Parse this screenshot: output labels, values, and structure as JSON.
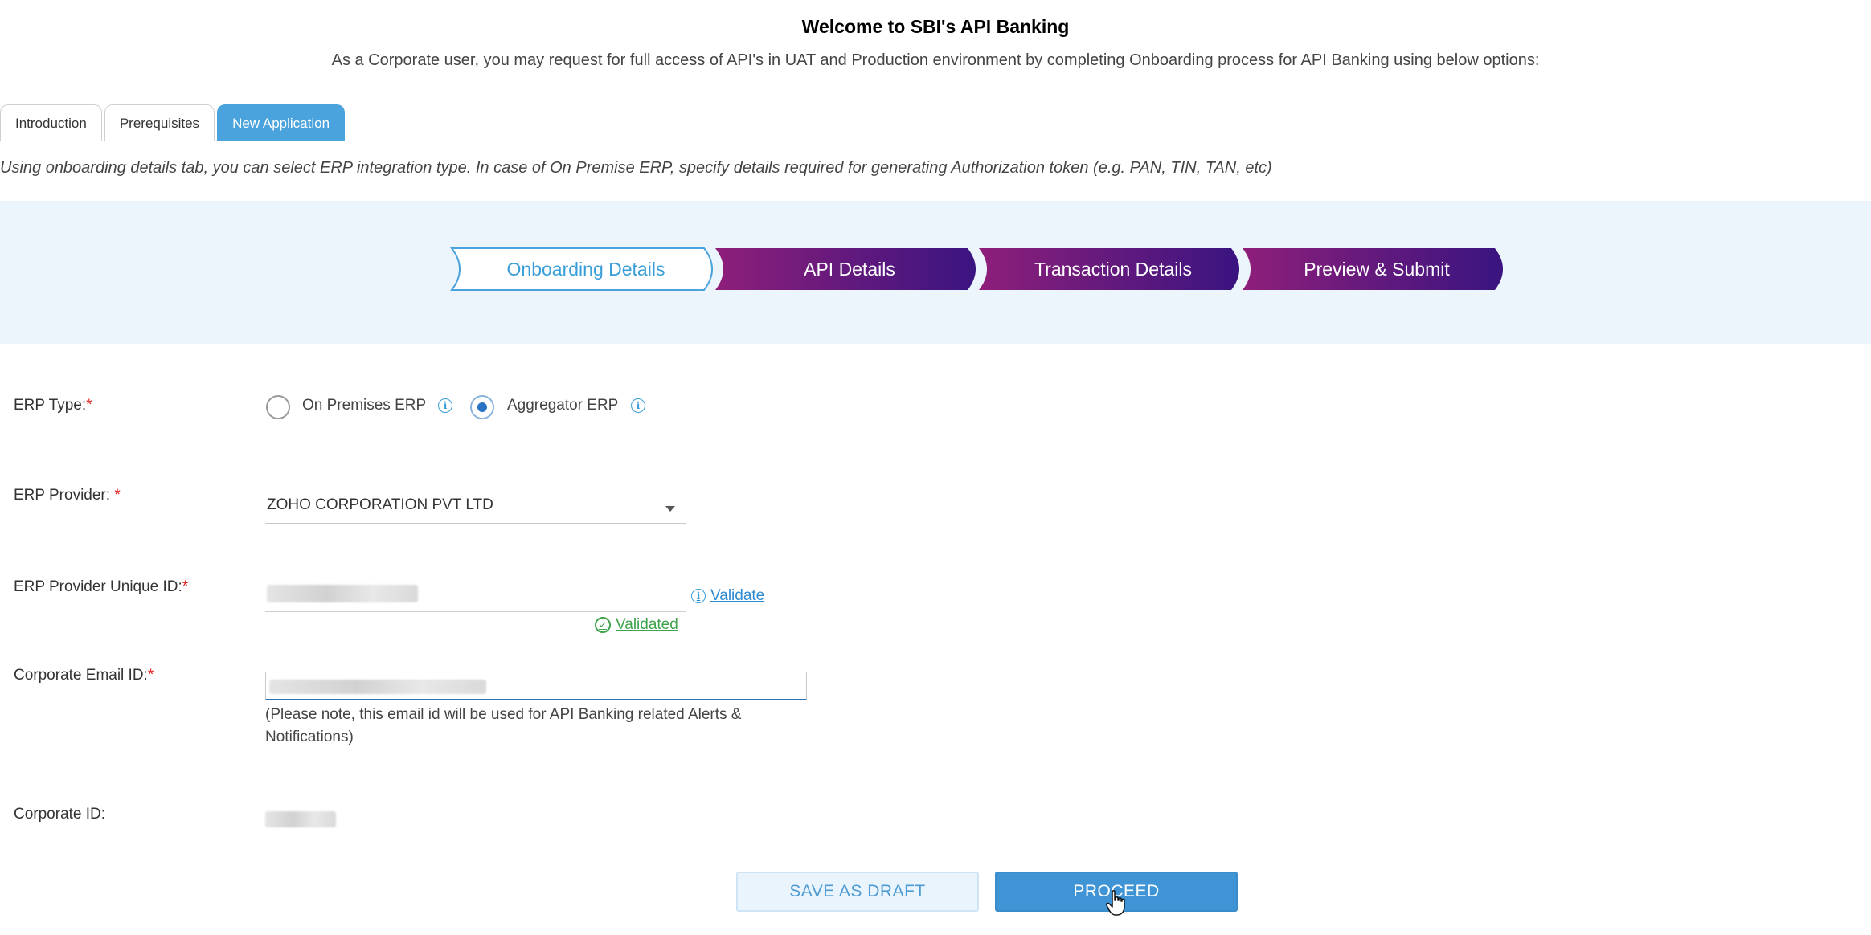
{
  "header": {
    "title": "Welcome to SBI's API Banking",
    "subtitle": "As a Corporate user, you may request for full access of API's in UAT and Production environment by completing Onboarding process for API Banking using below options:"
  },
  "tabs": [
    {
      "label": "Introduction",
      "active": false
    },
    {
      "label": "Prerequisites",
      "active": false
    },
    {
      "label": "New Application",
      "active": true
    }
  ],
  "intro_text": "Using onboarding details tab, you can select ERP integration type. In case of On Premise ERP, specify details required for generating Authorization token (e.g. PAN, TIN, TAN, etc)",
  "steps": [
    {
      "label": "Onboarding Details",
      "active": true
    },
    {
      "label": "API Details",
      "active": false
    },
    {
      "label": "Transaction Details",
      "active": false
    },
    {
      "label": "Preview & Submit",
      "active": false
    }
  ],
  "form": {
    "erp_type": {
      "label": "ERP Type:",
      "required_mark": "*",
      "options": [
        {
          "label": "On Premises ERP",
          "selected": false
        },
        {
          "label": "Aggregator ERP",
          "selected": true
        }
      ]
    },
    "erp_provider": {
      "label": "ERP Provider: ",
      "required_mark": "*",
      "value": "ZOHO CORPORATION PVT LTD"
    },
    "erp_provider_uid": {
      "label": "ERP Provider Unique ID:",
      "required_mark": "*",
      "validate_label": "Validate",
      "status": "Validated"
    },
    "corporate_email": {
      "label": "Corporate Email ID:",
      "required_mark": "*",
      "note": "(Please note, this email id will be used for API Banking related Alerts & Notifications)"
    },
    "corporate_id": {
      "label": "Corporate ID:"
    }
  },
  "buttons": {
    "save_draft": "SAVE AS DRAFT",
    "proceed": "PROCEED"
  },
  "colors": {
    "accent": "#4aa3dc",
    "step_gradient_start": "#8e1f7a",
    "step_gradient_end": "#3a1480",
    "required": "#e02020",
    "success": "#3ea34a"
  },
  "icons": {
    "info": "info-icon",
    "check": "check-circle-icon",
    "dropdown": "chevron-down-icon",
    "cursor": "hand-pointer-icon"
  }
}
